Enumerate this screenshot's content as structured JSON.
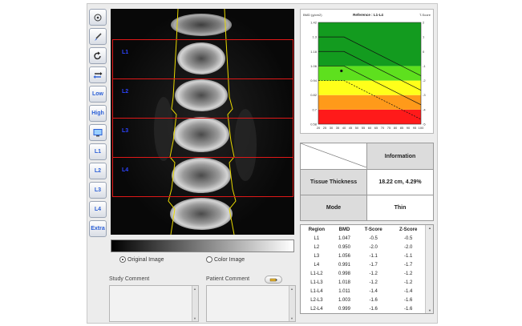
{
  "toolbar": [
    {
      "name": "crosshair-tool-button",
      "icon": "crosshair-icon",
      "label": ""
    },
    {
      "name": "brush-tool-button",
      "icon": "brush-icon",
      "label": ""
    },
    {
      "name": "rotate-tool-button",
      "icon": "rotate-icon",
      "label": ""
    },
    {
      "name": "flip-tool-button",
      "icon": "flip-icon",
      "label": ""
    },
    {
      "name": "low-button",
      "icon": "",
      "label": "Low"
    },
    {
      "name": "high-button",
      "icon": "",
      "label": "High"
    },
    {
      "name": "monitor-button",
      "icon": "monitor-icon",
      "label": ""
    },
    {
      "name": "l1-button",
      "icon": "",
      "label": "L1"
    },
    {
      "name": "l2-button",
      "icon": "",
      "label": "L2"
    },
    {
      "name": "l3-button",
      "icon": "",
      "label": "L3"
    },
    {
      "name": "l4-button",
      "icon": "",
      "label": "L4"
    },
    {
      "name": "extra-button",
      "icon": "",
      "label": "Extra"
    }
  ],
  "scan": {
    "regions": [
      "L1",
      "L2",
      "L3",
      "L4"
    ]
  },
  "view_options": {
    "original": "Original Image",
    "color": "Color Image",
    "selected": "original"
  },
  "comments": {
    "study_label": "Study Comment",
    "patient_label": "Patient Comment"
  },
  "chart_data": {
    "type": "line",
    "title": "Reference : L1-L4",
    "ylabel": "BMD (g/cm2)",
    "y2label": "T-Score",
    "xlabel": "",
    "x_ticks": [
      20,
      25,
      30,
      35,
      40,
      45,
      50,
      55,
      60,
      65,
      70,
      75,
      80,
      85,
      90,
      95,
      100
    ],
    "y_ticks": [
      0.58,
      0.7,
      0.82,
      0.94,
      1.06,
      1.18,
      1.3,
      1.42
    ],
    "y2_ticks": [
      -5,
      -4,
      -3,
      -2,
      -1,
      0,
      1,
      2
    ],
    "xlim": [
      20,
      100
    ],
    "ylim": [
      0.58,
      1.42
    ],
    "y2lim": [
      -5,
      2
    ],
    "bands": [
      {
        "from": 0.58,
        "to": 0.7,
        "color": "#ff1a1a"
      },
      {
        "from": 0.7,
        "to": 0.82,
        "color": "#ff9a1a"
      },
      {
        "from": 0.82,
        "to": 0.94,
        "color": "#ffff1a"
      },
      {
        "from": 0.94,
        "to": 1.06,
        "color": "#5ee01e"
      },
      {
        "from": 1.06,
        "to": 1.42,
        "color": "#139b1f"
      }
    ],
    "series": [
      {
        "x": [
          20,
          40,
          100
        ],
        "y": [
          1.3,
          1.3,
          0.98
        ],
        "style": "solid"
      },
      {
        "x": [
          20,
          40,
          100
        ],
        "y": [
          1.18,
          1.18,
          0.86
        ],
        "style": "solid"
      },
      {
        "x": [
          20,
          40,
          100
        ],
        "y": [
          1.06,
          1.06,
          0.74
        ],
        "style": "solid"
      },
      {
        "x": [
          20,
          40,
          100
        ],
        "y": [
          0.94,
          0.94,
          0.62
        ],
        "style": "dashed"
      }
    ],
    "points": [
      {
        "x": 38,
        "y": 1.02
      }
    ]
  },
  "info": {
    "header": "Information",
    "rows": [
      {
        "label": "Tissue Thickness",
        "value": "18.22 cm, 4.29%"
      },
      {
        "label": "Mode",
        "value": "Thin"
      }
    ]
  },
  "results": {
    "columns": [
      "Region",
      "BMD",
      "T-Score",
      "Z-Score"
    ],
    "rows": [
      [
        "L1",
        "1.047",
        "-0.5",
        "-0.5"
      ],
      [
        "L2",
        "0.950",
        "-2.0",
        "-2.0"
      ],
      [
        "L3",
        "1.056",
        "-1.1",
        "-1.1"
      ],
      [
        "L4",
        "0.991",
        "-1.7",
        "-1.7"
      ],
      [
        "L1-L2",
        "0.998",
        "-1.2",
        "-1.2"
      ],
      [
        "L1-L3",
        "1.018",
        "-1.2",
        "-1.2"
      ],
      [
        "L1-L4",
        "1.011",
        "-1.4",
        "-1.4"
      ],
      [
        "L2-L3",
        "1.003",
        "-1.6",
        "-1.6"
      ],
      [
        "L2-L4",
        "0.999",
        "-1.6",
        "-1.6"
      ]
    ]
  },
  "colors": {
    "roi": "#e01818",
    "roi_label": "#2d44ff",
    "spine_outline": "#e8d800",
    "tool_text": "#2b5fd6"
  }
}
